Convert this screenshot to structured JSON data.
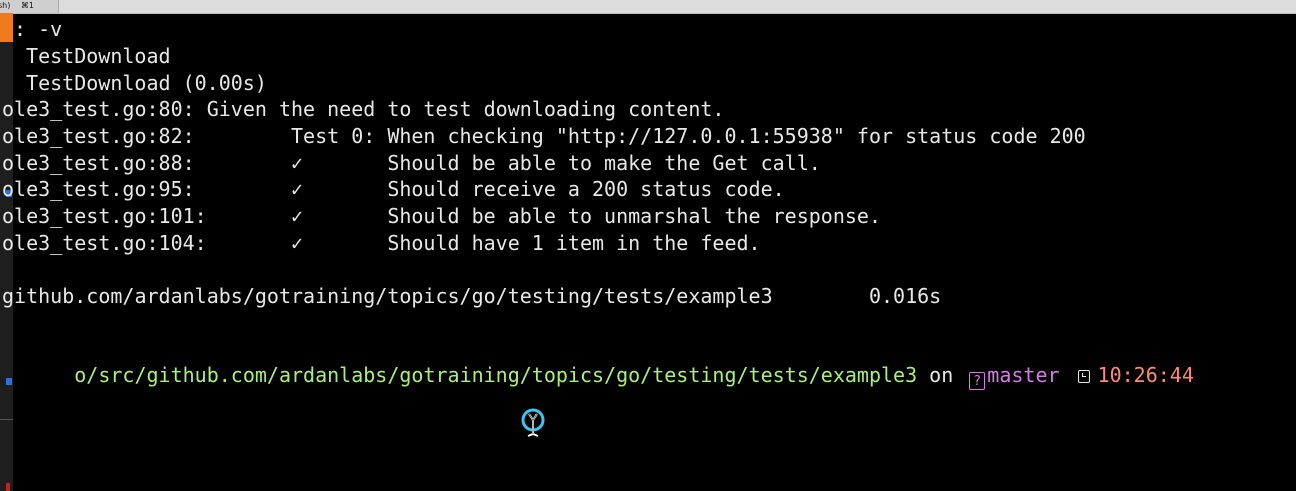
{
  "tab": {
    "name": "sh)",
    "shortcut": "⌘1"
  },
  "terminal": {
    "lines": [
      ": -v",
      " TestDownload",
      " TestDownload (0.00s)",
      "ole3_test.go:80: Given the need to test downloading content.",
      "ole3_test.go:82:        Test 0: When checking \"http://127.0.0.1:55938\" for status code 200",
      "ole3_test.go:88:        ✓       Should be able to make the Get call.",
      "ole3_test.go:95:        ✓       Should receive a 200 status code.",
      "ole3_test.go:101:       ✓       Should be able to unmarshal the response.",
      "ole3_test.go:104:       ✓       Should have 1 item in the feed.",
      "",
      "github.com/ardanlabs/gotraining/topics/go/testing/tests/example3        0.016s",
      ""
    ],
    "prompt": {
      "path": "o/src/github.com/ardanlabs/gotraining/topics/go/testing/tests/example3",
      "on": " on ",
      "git_icon": "?",
      "branch": "master",
      "time": "10:26:44"
    }
  },
  "icons": {
    "git": "question-box-icon",
    "clock": "clock-icon",
    "cursor": "text-cursor-icon"
  },
  "colors": {
    "background": "#000000",
    "text": "#e8e8e8",
    "path": "#a8f07a",
    "branch": "#d77be8",
    "time": "#ff8a78"
  }
}
